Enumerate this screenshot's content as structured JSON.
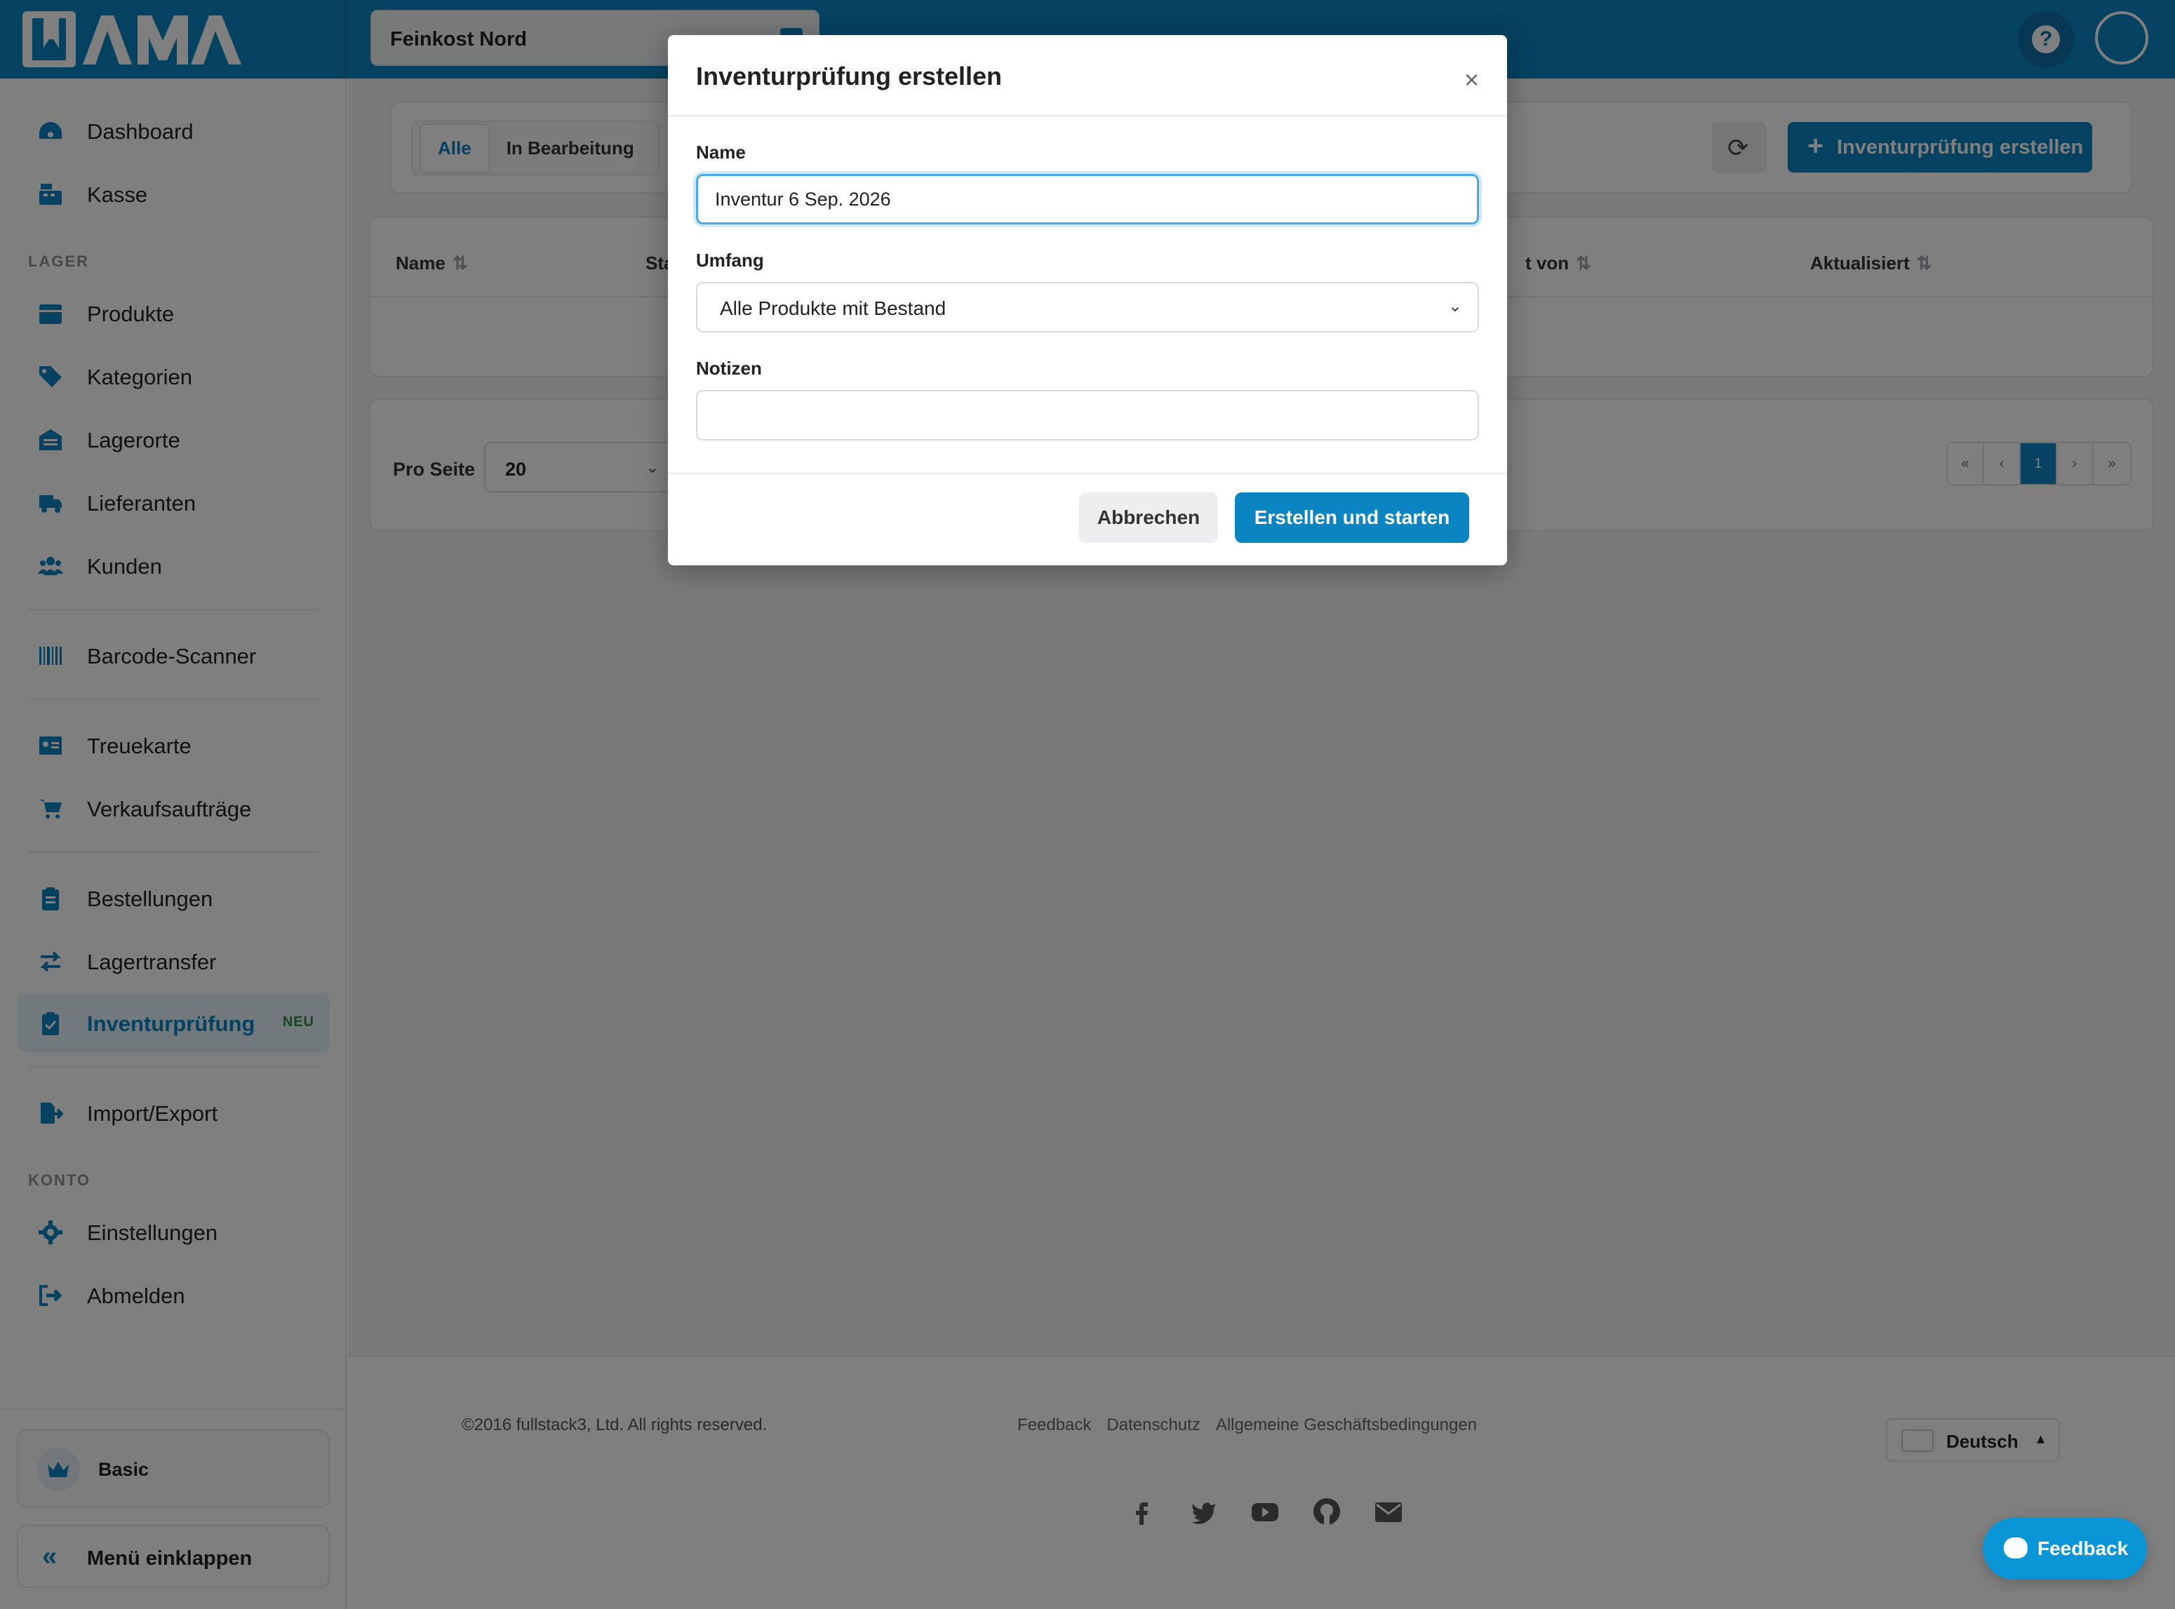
{
  "app": {
    "logo_text": "WAMA"
  },
  "header": {
    "store": "Feinkost Nord"
  },
  "sidebar": {
    "items_top": [
      {
        "label": "Dashboard",
        "icon": "dashboard-icon"
      },
      {
        "label": "Kasse",
        "icon": "cash-register-icon"
      }
    ],
    "section_lager": "LAGER",
    "items_lager": [
      {
        "label": "Produkte",
        "icon": "box-icon"
      },
      {
        "label": "Kategorien",
        "icon": "tags-icon"
      },
      {
        "label": "Lagerorte",
        "icon": "warehouse-icon"
      },
      {
        "label": "Lieferanten",
        "icon": "truck-icon"
      },
      {
        "label": "Kunden",
        "icon": "users-icon"
      }
    ],
    "item_barcode": {
      "label": "Barcode-Scanner",
      "icon": "barcode-icon"
    },
    "items_sales": [
      {
        "label": "Treuekarte",
        "icon": "id-card-icon"
      },
      {
        "label": "Verkaufsaufträge",
        "icon": "cart-icon"
      }
    ],
    "items_stock": [
      {
        "label": "Bestellungen",
        "icon": "clipboard-icon"
      },
      {
        "label": "Lagertransfer",
        "icon": "transfer-icon"
      },
      {
        "label": "Inventurprüfung",
        "icon": "clipboard-check-icon",
        "badge": "NEU"
      }
    ],
    "item_import": {
      "label": "Import/Export",
      "icon": "file-export-icon"
    },
    "section_konto": "KONTO",
    "items_konto": [
      {
        "label": "Einstellungen",
        "icon": "gear-icon"
      },
      {
        "label": "Abmelden",
        "icon": "logout-icon"
      }
    ],
    "plan": "Basic",
    "collapse": "Menü einklappen"
  },
  "main": {
    "tabs": [
      "Alle",
      "In Bearbeitung"
    ],
    "create_button": "Inventurprüfung erstellen",
    "columns": [
      "Name",
      "Sta",
      "t von",
      "Aktualisiert"
    ],
    "per_page_label": "Pro Seite",
    "per_page_value": "20",
    "pagination": [
      "«",
      "‹",
      "1",
      "›",
      "»"
    ]
  },
  "footer": {
    "copyright": "©2016 fullstack3, Ltd. All rights reserved.",
    "links": [
      "Feedback",
      "Datenschutz",
      "Allgemeine Geschäftsbedingungen"
    ],
    "language": "Deutsch"
  },
  "modal": {
    "title": "Inventurprüfung erstellen",
    "name_label": "Name",
    "name_value": "Inventur 6 Sep. 2026",
    "scope_label": "Umfang",
    "scope_value": "Alle Produkte mit Bestand",
    "notes_label": "Notizen",
    "notes_value": "",
    "cancel": "Abbrechen",
    "submit": "Erstellen und starten"
  },
  "feedback_button": "Feedback",
  "colors": {
    "primary": "#0a85c2",
    "overlay": "rgba(0,0,0,0.5)",
    "badge_green": "#2e8b3f"
  }
}
